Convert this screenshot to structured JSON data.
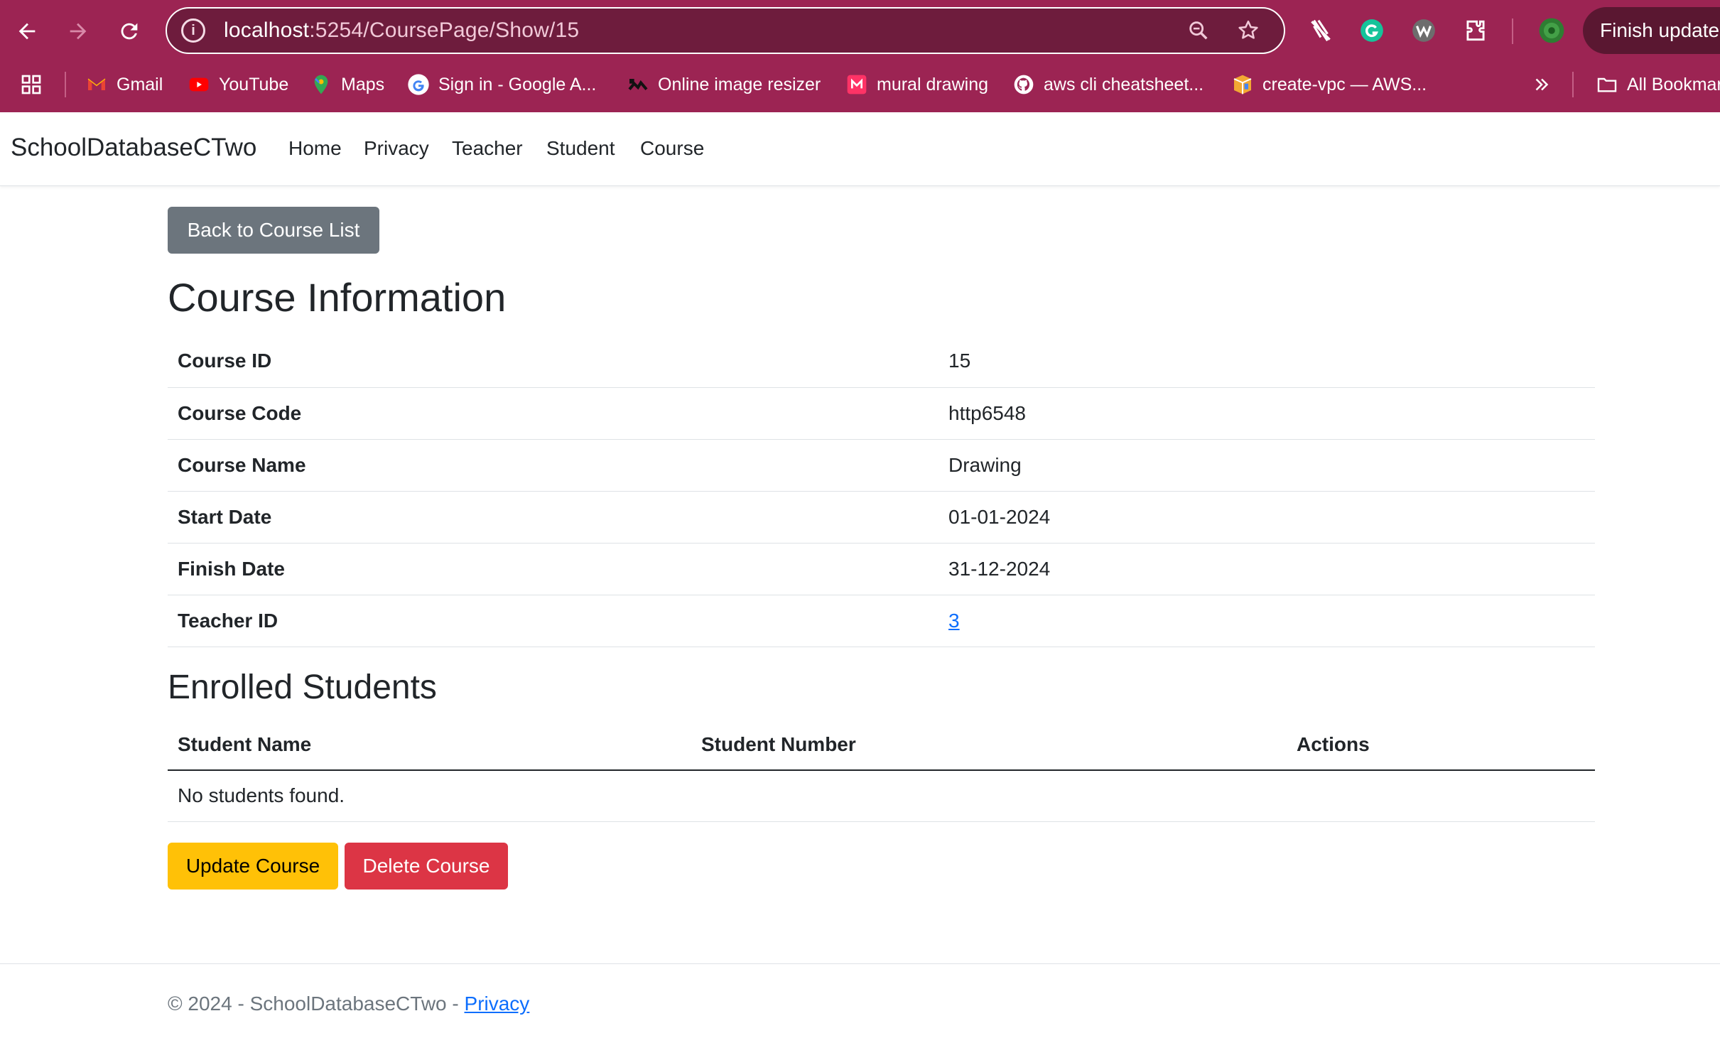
{
  "browser": {
    "url_host": "localhost",
    "url_path": ":5254/CoursePage/Show/15",
    "finish_update_label": "Finish update",
    "bookmarks": [
      {
        "label": "Gmail",
        "icon": "gmail-icon"
      },
      {
        "label": "YouTube",
        "icon": "youtube-icon"
      },
      {
        "label": "Maps",
        "icon": "maps-icon"
      },
      {
        "label": "Sign in - Google A...",
        "icon": "google-icon"
      },
      {
        "label": "Online image resizer",
        "icon": "resizer-icon"
      },
      {
        "label": "mural drawing",
        "icon": "mural-icon"
      },
      {
        "label": "aws cli cheatsheet...",
        "icon": "github-icon"
      },
      {
        "label": "create-vpc — AWS...",
        "icon": "aws-box-icon"
      }
    ],
    "all_bookmarks_label": "All Bookmarks",
    "colors": {
      "chrome": "#9c2453",
      "omnibox": "#6e1c3d"
    }
  },
  "navbar": {
    "brand": "SchoolDatabaseCTwo",
    "links": [
      "Home",
      "Privacy",
      "Teacher",
      "Student",
      "Course"
    ]
  },
  "main": {
    "back_button": "Back to Course List",
    "course_heading": "Course Information",
    "course_info": [
      {
        "label": "Course ID",
        "value": "15"
      },
      {
        "label": "Course Code",
        "value": "http6548"
      },
      {
        "label": "Course Name",
        "value": "Drawing"
      },
      {
        "label": "Start Date",
        "value": "01-01-2024"
      },
      {
        "label": "Finish Date",
        "value": "31-12-2024"
      },
      {
        "label": "Teacher ID",
        "value": "3"
      }
    ],
    "students_heading": "Enrolled Students",
    "students_columns": [
      "Student Name",
      "Student Number",
      "Actions"
    ],
    "students_empty": "No students found.",
    "update_button": "Update Course",
    "delete_button": "Delete Course"
  },
  "footer": {
    "text": "© 2024 - SchoolDatabaseCTwo - ",
    "privacy_link": "Privacy"
  }
}
